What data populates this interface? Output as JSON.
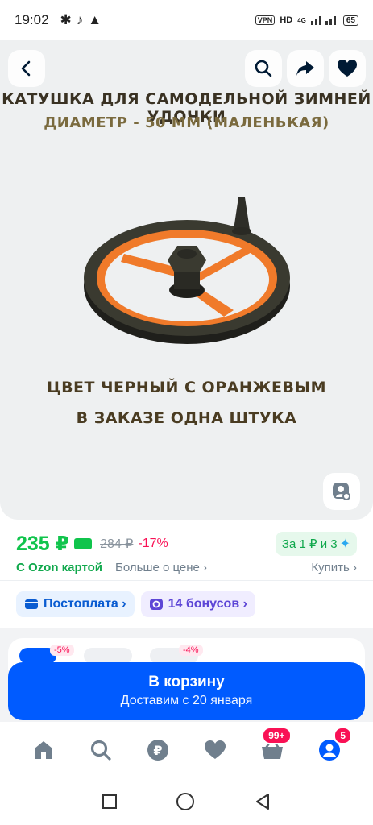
{
  "status_bar": {
    "time": "19:02",
    "vpn": "VPN",
    "hd": "HD",
    "network": "4G",
    "battery": "65"
  },
  "header": {
    "back_icon": "back-arrow-icon",
    "search_icon": "search-icon",
    "share_icon": "share-icon",
    "favorite_icon": "heart-icon"
  },
  "product_image": {
    "title_line1": "КАТУШКА ДЛЯ САМОДЕЛЬНОЙ ЗИМНЕЙ УДОЧКИ",
    "title_line2": "ДИАМЕТР - 50 ММ (МАЛЕНЬКАЯ)",
    "caption_line1": "ЦВЕТ ЧЕРНЫЙ С ОРАНЖЕВЫМ",
    "caption_line2": "В ЗАКАЗЕ ОДНА ШТУКА",
    "colors": {
      "body": "#2e2e28",
      "accent": "#f07a2a"
    }
  },
  "price": {
    "current": "235 ₽",
    "old": "284 ₽",
    "discount": "-17%",
    "installment": "За 1 ₽ и 3",
    "ozon_card": "С Ozon картой",
    "more_price": "Больше о цене ›",
    "buy": "Купить ›"
  },
  "chips": {
    "postpay": "Постоплата ›",
    "bonuses": "14 бонусов ›"
  },
  "peek": {
    "tag1": "-5%",
    "tag2": "-4%"
  },
  "cta": {
    "label": "В корзину",
    "delivery": "Доставим с 20 января"
  },
  "tabbar": {
    "cart_badge": "99+",
    "profile_badge": "5"
  },
  "colors": {
    "ozon_blue": "#005bff",
    "price_green": "#10c44c",
    "discount_red": "#f91155"
  }
}
